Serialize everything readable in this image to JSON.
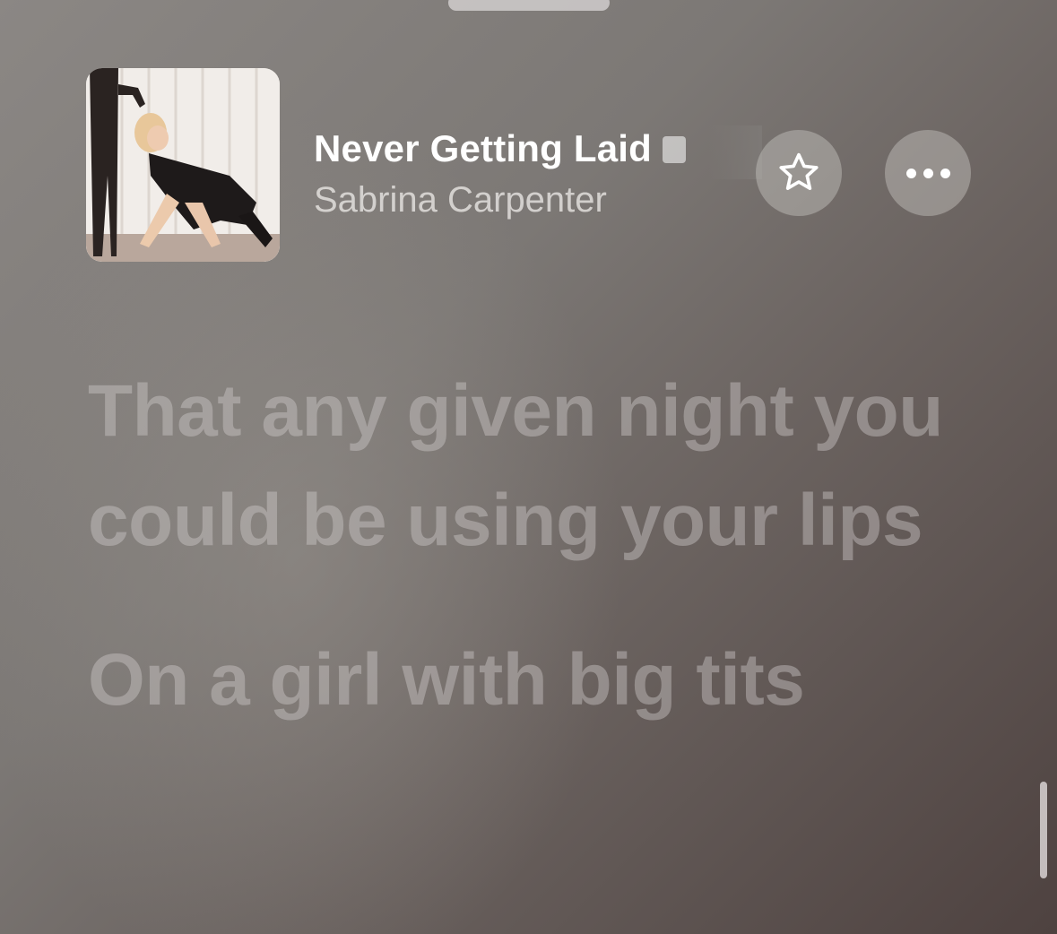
{
  "now_playing": {
    "title": "Never Getting Laid",
    "artist": "Sabrina Carpenter"
  },
  "actions": {
    "favorite_icon": "star-icon",
    "more_icon": "ellipsis-icon"
  },
  "lyrics": [
    "That any given night you could be using your lips",
    "On a girl with big tits"
  ]
}
